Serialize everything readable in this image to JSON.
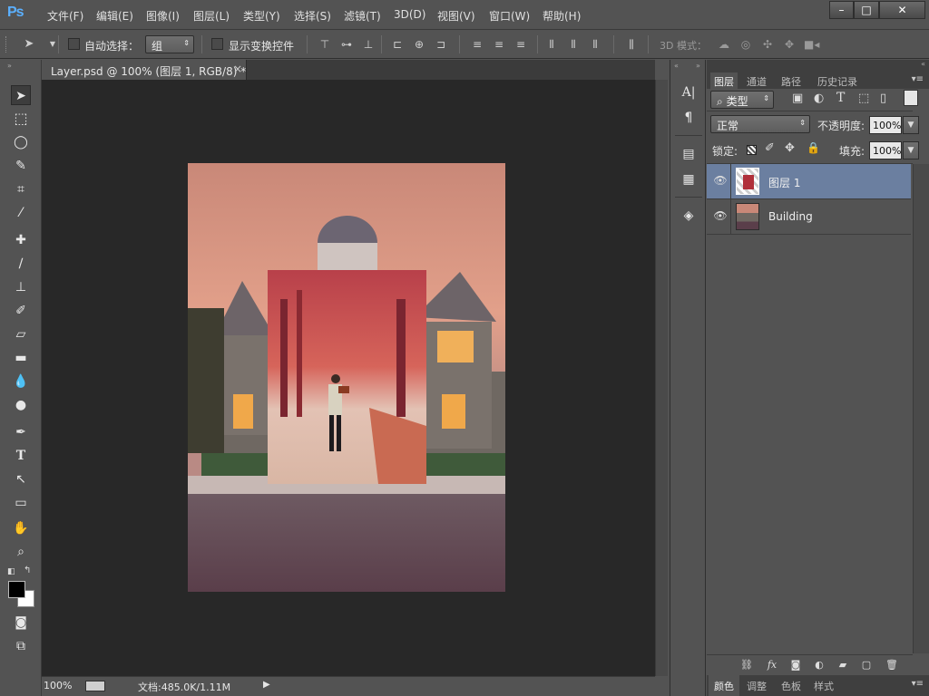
{
  "app": {
    "logo": "Ps"
  },
  "menu": [
    "文件(F)",
    "编辑(E)",
    "图像(I)",
    "图层(L)",
    "类型(Y)",
    "选择(S)",
    "滤镜(T)",
    "3D(D)",
    "视图(V)",
    "窗口(W)",
    "帮助(H)"
  ],
  "window_controls": {
    "minimize": "–",
    "maximize": "□",
    "close": "✕"
  },
  "options": {
    "auto_select_label": "自动选择：",
    "auto_select_value": "组",
    "show_transform_label": "显示变换控件",
    "mode_3d_label": "3D 模式："
  },
  "document": {
    "tab_title": "Layer.psd @ 100% (图层 1, RGB/8) *",
    "tab_close": "×",
    "zoom": "100%",
    "doc_info": "文档:485.0K/1.11M"
  },
  "layers_panel": {
    "tabs": [
      "图层",
      "通道",
      "路径",
      "历史记录"
    ],
    "filter_label": "类型",
    "blend_mode": "正常",
    "opacity_label": "不透明度:",
    "opacity_value": "100%",
    "lock_label": "锁定:",
    "fill_label": "填充:",
    "fill_value": "100%",
    "layers": [
      {
        "name": "图层 1",
        "selected": true
      },
      {
        "name": "Building",
        "selected": false
      }
    ]
  },
  "bottom_tabs": [
    "颜色",
    "调整",
    "色板",
    "样式"
  ],
  "colors": {
    "ui_bg": "#535353",
    "canvas_bg": "#282828",
    "selected_layer": "#6b7fa0",
    "ps_blue": "#5bb0ff"
  }
}
